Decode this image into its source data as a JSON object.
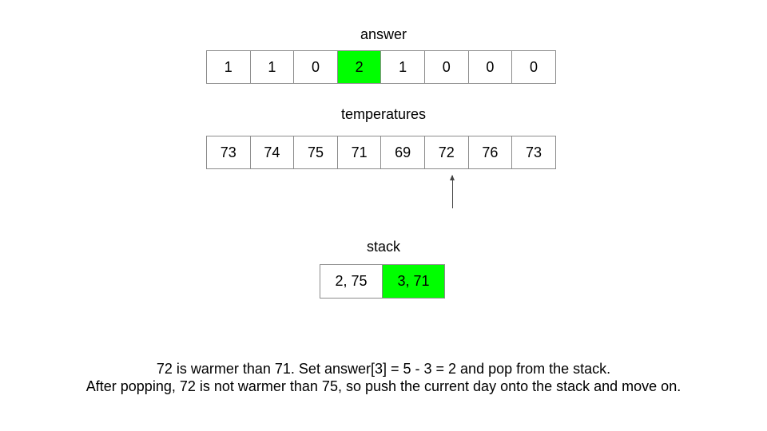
{
  "answer": {
    "label": "answer",
    "values": [
      "1",
      "1",
      "0",
      "2",
      "1",
      "0",
      "0",
      "0"
    ],
    "highlight_index": 3,
    "highlight_color": "#00ff00"
  },
  "temperatures": {
    "label": "temperatures",
    "values": [
      "73",
      "74",
      "75",
      "71",
      "69",
      "72",
      "76",
      "73"
    ],
    "pointer_index": 5
  },
  "stack": {
    "label": "stack",
    "values": [
      "2, 75",
      "3, 71"
    ],
    "highlight_index": 1,
    "highlight_color": "#00ff00"
  },
  "caption": {
    "line1": "72 is warmer than 71. Set answer[3] = 5 - 3 = 2 and pop from the stack.",
    "line2": "After popping, 72 is not warmer than 75, so push the current day onto the stack and move on."
  }
}
